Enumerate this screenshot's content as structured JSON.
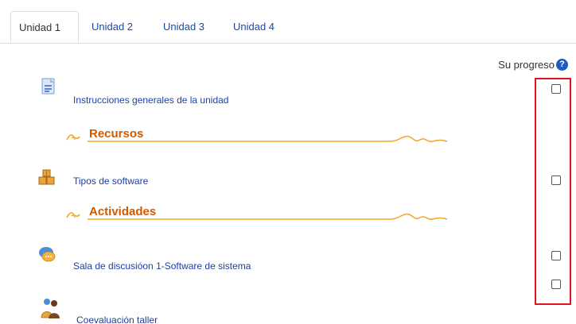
{
  "tabs": [
    {
      "label": "Unidad 1",
      "active": true
    },
    {
      "label": "Unidad 2",
      "active": false
    },
    {
      "label": "Unidad 3",
      "active": false
    },
    {
      "label": "Unidad 4",
      "active": false
    }
  ],
  "progress": {
    "label": "Su progreso",
    "help_glyph": "?"
  },
  "sections": [
    {
      "title": "Recursos"
    },
    {
      "title": "Actividades"
    }
  ],
  "activities": [
    {
      "label": "Instrucciones generales de la unidad",
      "icon": "page-icon",
      "completed": false
    },
    {
      "label": "Tipos de software",
      "icon": "boxes-icon",
      "completed": false
    },
    {
      "label": "Sala de discusióon 1-Software de sistema",
      "icon": "forum-icon",
      "completed": false
    },
    {
      "label": "Coevaluación taller",
      "icon": "workshop-icon",
      "completed": false
    }
  ],
  "colors": {
    "link": "#1a3fa8",
    "section_title": "#d15a00",
    "section_line": "#f5a623",
    "highlight": "#e0141e",
    "help_icon": "#1f5bc6"
  }
}
